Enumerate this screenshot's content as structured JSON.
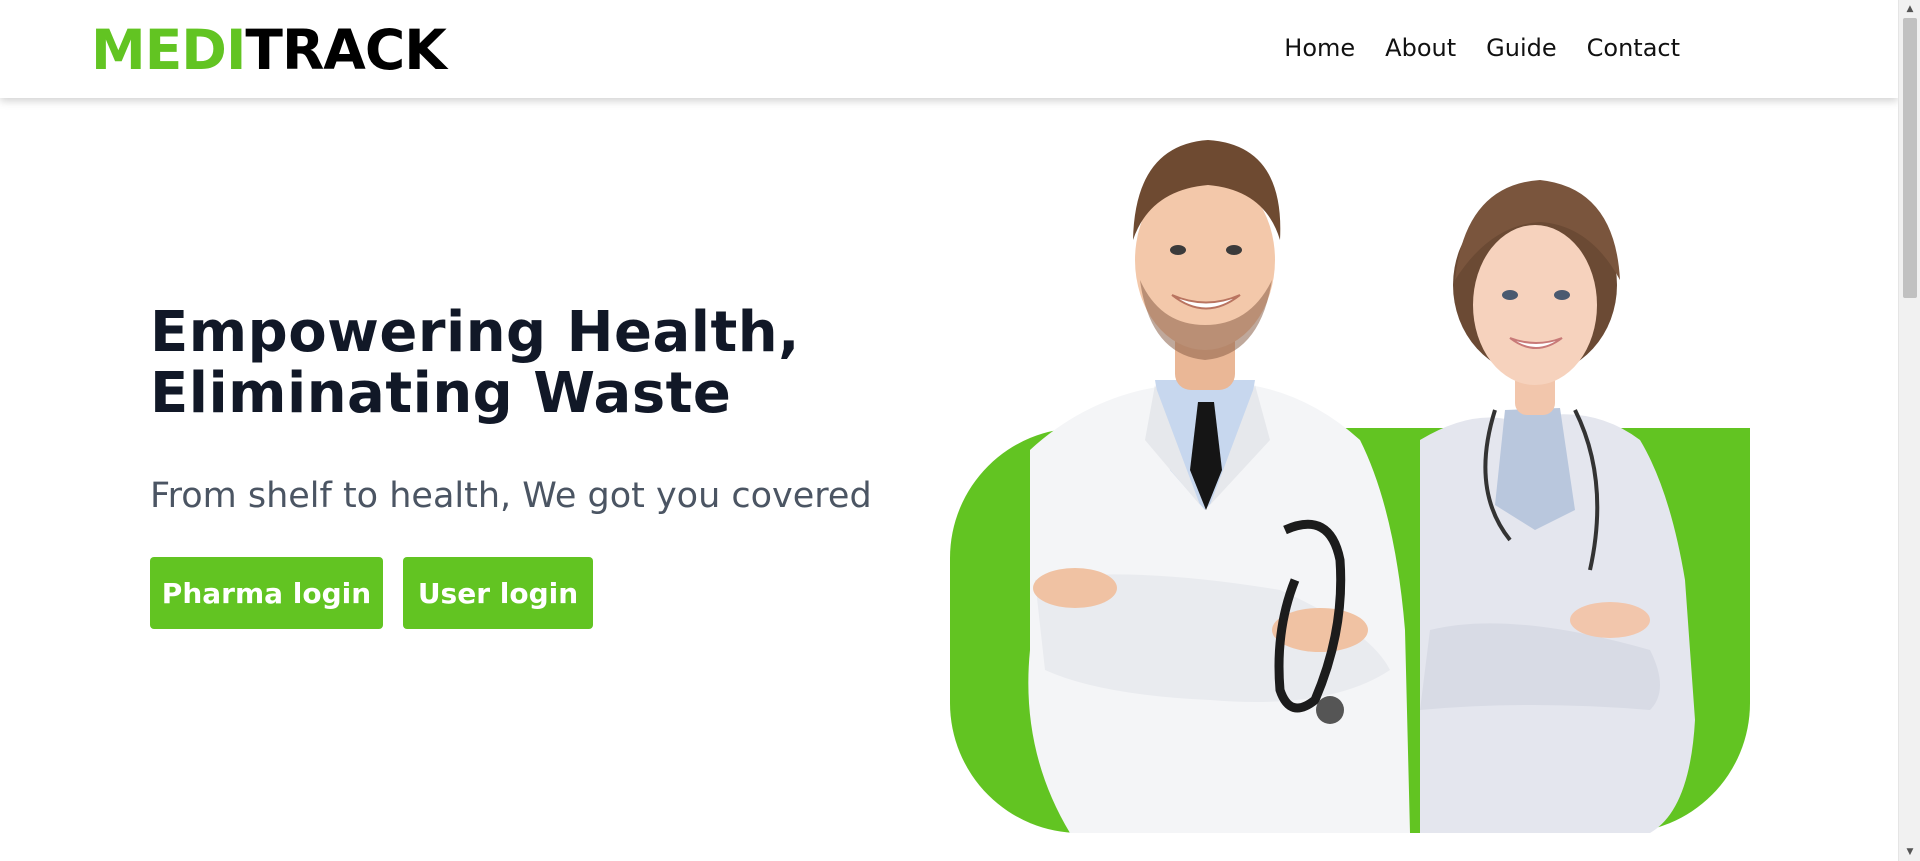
{
  "brand": {
    "logo_part1": "MEDI",
    "logo_part2": "TRACK",
    "accent_color": "#62c422"
  },
  "nav": {
    "items": [
      {
        "label": "Home"
      },
      {
        "label": "About"
      },
      {
        "label": "Guide"
      },
      {
        "label": "Contact"
      }
    ]
  },
  "hero": {
    "title_line1": "Empowering Health,",
    "title_line2": "Eliminating Waste",
    "subtitle": "From shelf to health, We got you covered",
    "pharma_login_label": "Pharma login",
    "user_login_label": "User login"
  },
  "scrollbar": {
    "up_icon": "▲",
    "down_icon": "▼"
  }
}
